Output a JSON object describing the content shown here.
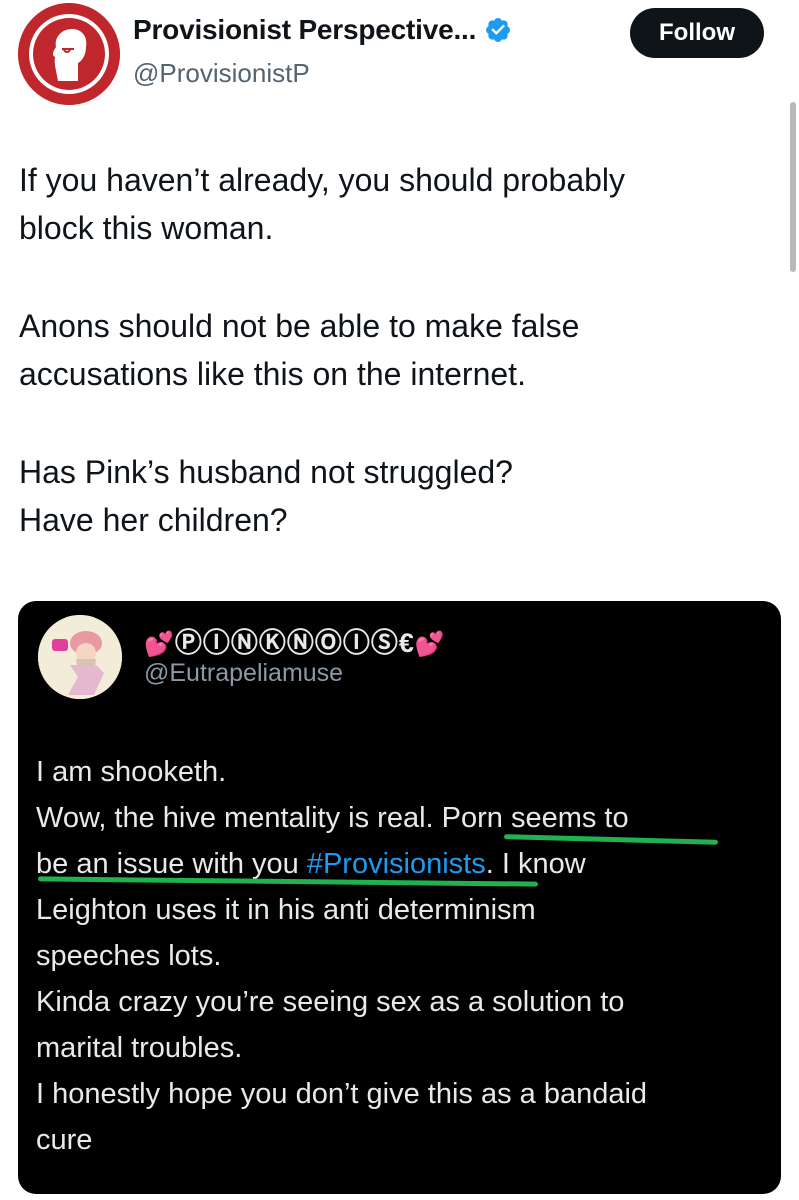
{
  "tweet": {
    "display_name": "Provisionist Perspective...",
    "handle": "@ProvisionistP",
    "follow_label": "Follow",
    "paragraphs": [
      [
        "If you haven’t already, you should probably",
        "block this woman."
      ],
      [
        "Anons should not be able to make false",
        "accusations like this on the internet."
      ],
      [
        "Has Pink’s husband not struggled?",
        "Have her children?"
      ]
    ]
  },
  "quoted_tweet": {
    "display_name_prefix": "💕",
    "display_name_main": "ⓅⒾⓃⓀⓃⓄⒾⓈ€",
    "display_name_suffix": "💕",
    "handle": "@Eutrapeliamuse",
    "lines": {
      "l1": "I am shooketh.",
      "l2a": "Wow, the hive mentality is real. ",
      "l2b": "Porn seems to",
      "l3a": "be an issue with you ",
      "l3hash": "#Provisionists",
      "l3b": ". I know",
      "l4": "Leighton uses it in his anti determinism",
      "l5": "speeches lots.",
      "l6": "Kinda crazy you’re seeing sex as a solution to",
      "l7": "marital troubles.",
      "l8": "I honestly hope you don’t give this as a bandaid",
      "l9": "cure"
    }
  },
  "colors": {
    "brand_red": "#c0272d",
    "verified_blue": "#1d9bf0",
    "hashtag_blue": "#1d9bf0",
    "highlight_green": "#1fb24f",
    "quote_bg": "#000000"
  },
  "icons": {
    "verified": "verified-badge-icon",
    "avatar": "profile-silhouette-icon"
  }
}
